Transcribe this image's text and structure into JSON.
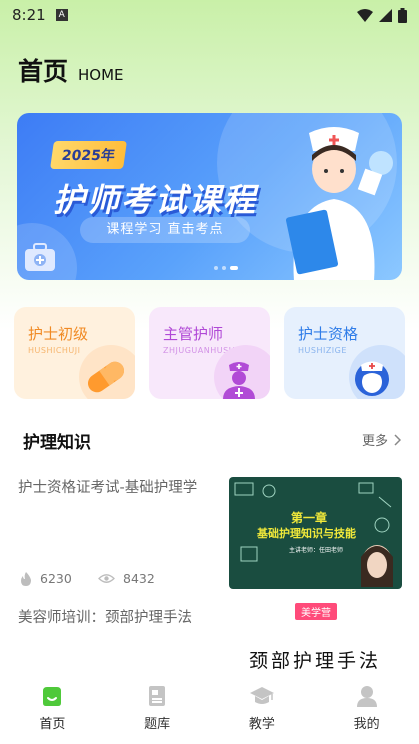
{
  "status_bar": {
    "time": "8:21",
    "app_badge": "A"
  },
  "header": {
    "title": "首页",
    "subtitle": "HOME"
  },
  "banner": {
    "year": "2025年",
    "title": "护师考试课程",
    "subtitle": "课程学习 直击考点",
    "active_slide": 2,
    "slide_count": 3
  },
  "categories": [
    {
      "title": "护士初级",
      "subtitle": "HUSHICHUJI",
      "title_color": "#f08a24",
      "bg": "#fff1de",
      "icon": "capsule-icon"
    },
    {
      "title": "主管护师",
      "subtitle": "ZHJUGUANHUSHI",
      "title_color": "#b048d6",
      "bg": "#f8e8fb",
      "icon": "nurse-icon"
    },
    {
      "title": "护士资格",
      "subtitle": "HUSHIZIGE",
      "title_color": "#2f7ce8",
      "bg": "#e6f0fd",
      "icon": "nurse-head-icon"
    }
  ],
  "section": {
    "title": "护理知识",
    "more": "更多"
  },
  "articles": [
    {
      "title": "护士资格证考试-基础护理学",
      "likes": "6230",
      "views": "8432",
      "thumb_chapter": "第一章",
      "thumb_title": "基础护理知识与技能",
      "thumb_teacher": "主讲老师：任田老师"
    },
    {
      "title": "美容师培训：颈部护理手法",
      "thumb_tag": "美学营",
      "thumb_title": "颈部护理手法"
    }
  ],
  "tabbar": [
    {
      "label": "首页",
      "icon": "home-icon",
      "active": true
    },
    {
      "label": "题库",
      "icon": "question-bank-icon",
      "active": false
    },
    {
      "label": "教学",
      "icon": "graduation-cap-icon",
      "active": false
    },
    {
      "label": "我的",
      "icon": "profile-icon",
      "active": false
    }
  ],
  "colors": {
    "accent": "#4fc93a",
    "banner": "#3d7cf5"
  }
}
